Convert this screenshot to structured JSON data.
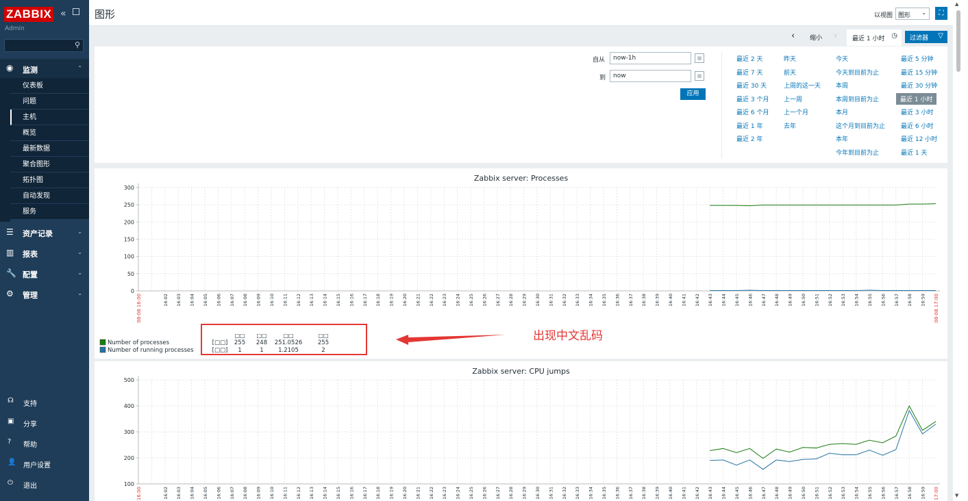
{
  "sidebar": {
    "brand": "ZABBIX",
    "user": "Admin",
    "search_placeholder": "",
    "monitoring": {
      "label": "监测",
      "icon": "eye-icon"
    },
    "monitoring_items": [
      "仪表板",
      "问题",
      "主机",
      "概览",
      "最新数据",
      "聚合图形",
      "拓扑图",
      "自动发现",
      "服务"
    ],
    "active_item": "主机",
    "sections": [
      {
        "label": "资产记录",
        "icon": "list-icon"
      },
      {
        "label": "报表",
        "icon": "chart-icon"
      },
      {
        "label": "配置",
        "icon": "wrench-icon"
      },
      {
        "label": "管理",
        "icon": "gear-icon"
      }
    ],
    "bottom": [
      {
        "label": "支持",
        "icon": "headset-icon"
      },
      {
        "label": "分享",
        "icon": "share-icon"
      },
      {
        "label": "帮助",
        "icon": "help-icon"
      },
      {
        "label": "用户设置",
        "icon": "user-icon"
      },
      {
        "label": "退出",
        "icon": "power-icon"
      }
    ]
  },
  "header": {
    "title": "图形",
    "view_as_label": "以视图",
    "view_as_value": "图形"
  },
  "filter_tabs": {
    "zoom_out": "缩小",
    "time_tab": "最近 1 小时",
    "filter_button": "过滤器"
  },
  "filter": {
    "from_label": "自从",
    "from_value": "now-1h",
    "to_label": "到",
    "to_value": "now",
    "apply": "应用",
    "quick_ranges": [
      [
        "最近 2 天",
        "最近 7 天",
        "最近 30 天",
        "最近 3 个月",
        "最近 6 个月",
        "最近 1 年",
        "最近 2 年"
      ],
      [
        "昨天",
        "前天",
        "上周的这一天",
        "上一周",
        "上一个月",
        "去年"
      ],
      [
        "今天",
        "今天到目前为止",
        "本周",
        "本周到目前为止",
        "本月",
        "这个月到目前为止",
        "本年",
        "今年到目前为止"
      ],
      [
        "最近 5 分钟",
        "最近 15 分钟",
        "最近 30 分钟",
        "最近 1 小时",
        "最近 3 小时",
        "最近 6 小时",
        "最近 12 小时",
        "最近 1 天"
      ]
    ],
    "selected_range": "最近 1 小时"
  },
  "colors": {
    "sidebar": "#1f3d58",
    "accent": "#0275b8",
    "series_green": "#1a7c11",
    "series_blue": "#2774a4",
    "annotation_red": "#e33734"
  },
  "time_axis": {
    "start_label": "08-08 16:00",
    "end_label": "08-08 17:00",
    "minute_ticks": [
      "16:02",
      "16:03",
      "16:04",
      "16:05",
      "16:06",
      "16:07",
      "16:08",
      "16:09",
      "16:10",
      "16:11",
      "16:12",
      "16:13",
      "16:14",
      "16:15",
      "16:16",
      "16:17",
      "16:18",
      "16:19",
      "16:20",
      "16:21",
      "16:22",
      "16:23",
      "16:24",
      "16:25",
      "16:26",
      "16:27",
      "16:28",
      "16:29",
      "16:30",
      "16:31",
      "16:32",
      "16:33",
      "16:34",
      "16:35",
      "16:36",
      "16:37",
      "16:38",
      "16:39",
      "16:40",
      "16:41",
      "16:42",
      "16:43",
      "16:44",
      "16:45",
      "16:46",
      "16:47",
      "16:48",
      "16:49",
      "16:50",
      "16:51",
      "16:52",
      "16:53",
      "16:54",
      "16:55",
      "16:56",
      "16:57",
      "16:58",
      "16:59"
    ]
  },
  "graph1": {
    "title": "Zabbix server: Processes",
    "legend_headers": [
      "□□",
      "□□",
      "□□",
      "□□"
    ],
    "legend": [
      {
        "name": "Number of processes",
        "unit": "[□□]",
        "last": "255",
        "min": "248",
        "avg": "251.0526",
        "max": "255",
        "color": "#1a7c11"
      },
      {
        "name": "Number of running processes",
        "unit": "[□□]",
        "last": "1",
        "min": "1",
        "avg": "1.2105",
        "max": "2",
        "color": "#2774a4"
      }
    ],
    "annotation": "出现中文乱码"
  },
  "graph2": {
    "title": "Zabbix server: CPU jumps"
  },
  "chart_data": [
    {
      "type": "line",
      "title": "Zabbix server: Processes",
      "xlabel": "",
      "ylabel": "",
      "ylim": [
        0,
        300
      ],
      "yticks": [
        0,
        50,
        100,
        150,
        200,
        250,
        300
      ],
      "x_minutes": [
        43,
        44,
        45,
        46,
        47,
        48,
        49,
        50,
        51,
        52,
        53,
        54,
        55,
        56,
        57,
        58,
        59,
        60
      ],
      "series": [
        {
          "name": "Number of processes",
          "values": [
            248,
            248,
            248,
            247,
            249,
            249,
            249,
            249,
            249,
            249,
            249,
            249,
            249,
            249,
            249,
            252,
            252,
            253
          ]
        },
        {
          "name": "Number of running processes",
          "values": [
            1,
            1,
            1,
            2,
            1,
            1,
            1,
            1,
            1,
            1,
            1,
            1,
            2,
            1,
            1,
            1,
            1,
            1
          ]
        }
      ]
    },
    {
      "type": "line",
      "title": "Zabbix server: CPU jumps",
      "xlabel": "",
      "ylabel": "",
      "ylim": [
        100,
        500
      ],
      "yticks": [
        100,
        200,
        300,
        400,
        500
      ],
      "x_minutes": [
        43,
        44,
        45,
        46,
        47,
        48,
        49,
        50,
        51,
        52,
        53,
        54,
        55,
        56,
        57,
        58,
        59,
        60
      ],
      "series": [
        {
          "name": "",
          "values": [
            228,
            236,
            220,
            236,
            198,
            234,
            222,
            240,
            238,
            252,
            255,
            252,
            268,
            258,
            284,
            400,
            306,
            340
          ]
        },
        {
          "name": "",
          "values": [
            190,
            192,
            172,
            192,
            156,
            192,
            186,
            194,
            196,
            218,
            212,
            212,
            230,
            210,
            232,
            382,
            292,
            330
          ]
        }
      ]
    }
  ]
}
